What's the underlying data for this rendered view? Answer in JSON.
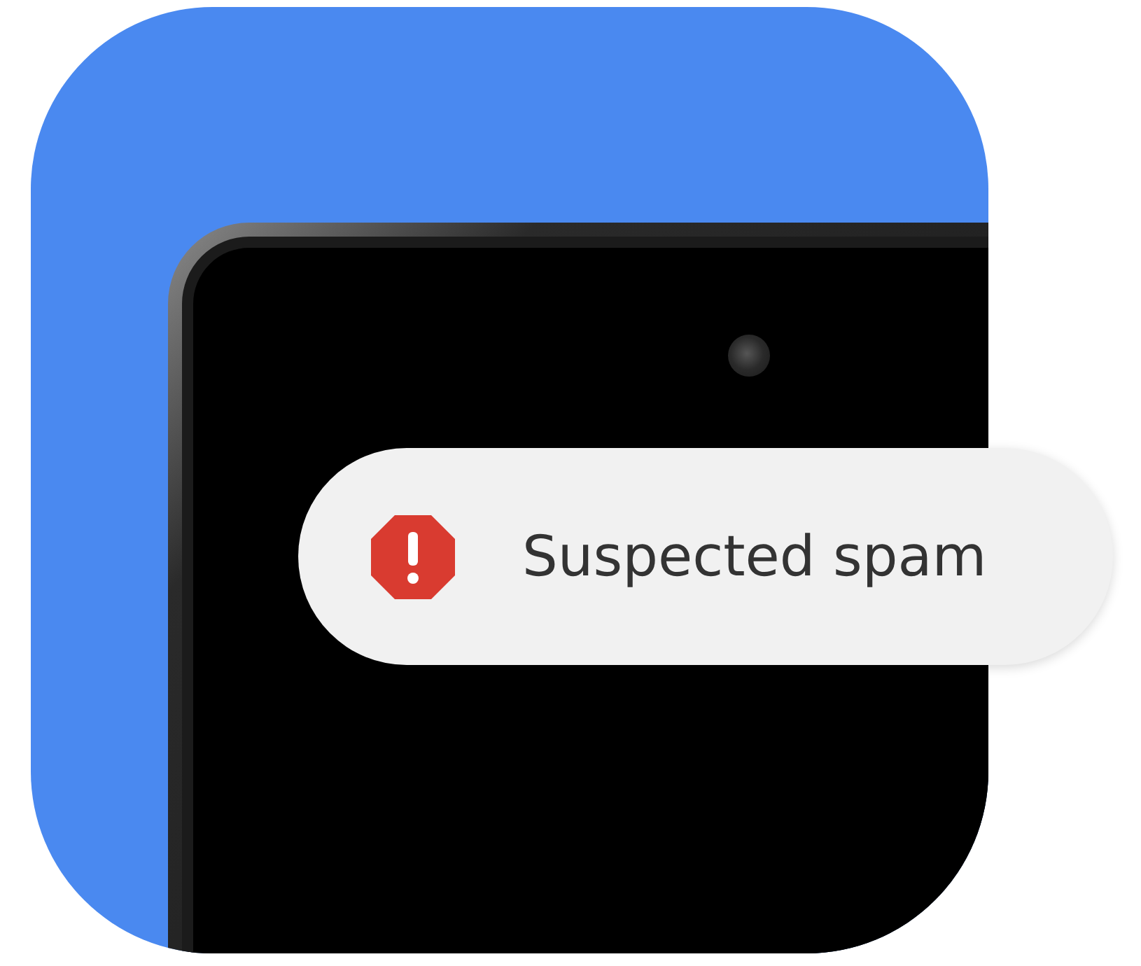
{
  "notification": {
    "text": "Suspected spam"
  }
}
